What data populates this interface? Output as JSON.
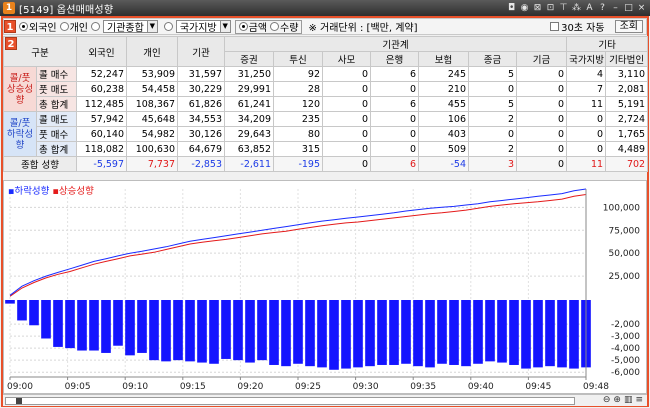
{
  "window": {
    "icon_text": "1",
    "title": "[5149] 옵션매매성향",
    "controls": [
      "◘",
      "◉",
      "⊠",
      "⊡",
      "⊤",
      "⁂",
      "A",
      "?",
      "–",
      "□",
      "×"
    ]
  },
  "toolbar": {
    "badge": "1",
    "investor_types": [
      {
        "label": "외국인",
        "selected": true
      },
      {
        "label": "개인",
        "selected": false
      },
      {
        "label": "",
        "selected": false
      },
      {
        "label": "",
        "selected": false
      }
    ],
    "institution_combo": "기관종합",
    "govt_combo": "국가지방",
    "amount_label": "금액",
    "amount_selected": true,
    "quantity_label": "수량",
    "unit_text": "※ 거래단위 : [백만, 계약]",
    "auto_label": "30초 자동",
    "query_button": "조회"
  },
  "grid": {
    "badge": "2",
    "header_top": {
      "category": "구분",
      "foreign": "외국인",
      "individual": "개인",
      "institution": "기관",
      "institution_group": "기관계",
      "other_group": "기타"
    },
    "header_sub": [
      "증권",
      "투신",
      "사모",
      "은행",
      "보험",
      "종금",
      "기금",
      "국가지방",
      "기타법인"
    ],
    "group_up": "콜/풋\n상승성향",
    "group_down": "콜/풋\n하락성향",
    "rows": [
      {
        "label": "콜 매수",
        "values": [
          "52,247",
          "53,909",
          "31,597",
          "31,250",
          "92",
          "0",
          "6",
          "245",
          "5",
          "0",
          "4",
          "3,110"
        ]
      },
      {
        "label": "풋 매도",
        "values": [
          "60,238",
          "54,458",
          "30,229",
          "29,991",
          "28",
          "0",
          "0",
          "210",
          "0",
          "0",
          "7",
          "2,081"
        ]
      },
      {
        "label": "총 합계",
        "values": [
          "112,485",
          "108,367",
          "61,826",
          "61,241",
          "120",
          "0",
          "6",
          "455",
          "5",
          "0",
          "11",
          "5,191"
        ]
      },
      {
        "label": "콜 매도",
        "values": [
          "57,942",
          "45,648",
          "34,553",
          "34,209",
          "235",
          "0",
          "0",
          "106",
          "2",
          "0",
          "0",
          "2,724"
        ]
      },
      {
        "label": "풋 매수",
        "values": [
          "60,140",
          "54,982",
          "30,126",
          "29,643",
          "80",
          "0",
          "0",
          "403",
          "0",
          "0",
          "0",
          "1,765"
        ]
      },
      {
        "label": "총 합계",
        "values": [
          "118,082",
          "100,630",
          "64,679",
          "63,852",
          "315",
          "0",
          "0",
          "509",
          "2",
          "0",
          "0",
          "4,489"
        ]
      }
    ],
    "summary": {
      "label": "종합 성향",
      "values": [
        "-5,597",
        "7,737",
        "-2,853",
        "-2,611",
        "-195",
        "0",
        "6",
        "-54",
        "3",
        "0",
        "11",
        "702"
      ],
      "colors": [
        "blue",
        "red",
        "blue",
        "blue",
        "blue",
        "black",
        "red",
        "blue",
        "red",
        "black",
        "red",
        "red"
      ]
    }
  },
  "chart_data": {
    "type": "line+bar",
    "legend": [
      {
        "name": "하락성향",
        "color": "#1a2cff"
      },
      {
        "name": "상승성향",
        "color": "#e41a1a"
      }
    ],
    "x_ticks": [
      "09:00",
      "09:05",
      "09:10",
      "09:15",
      "09:20",
      "09:25",
      "09:30",
      "09:35",
      "09:40",
      "09:45",
      "09:48"
    ],
    "upper_y_ticks": [
      "100,000",
      "75,000",
      "50,000",
      "25,000"
    ],
    "upper_y_values": [
      100000,
      75000,
      50000,
      25000
    ],
    "upper_ylim": [
      0,
      120000
    ],
    "lower_y_ticks": [
      "-2,000",
      "-3,000",
      "-4,000",
      "-5,000",
      "-6,000"
    ],
    "lower_y_values": [
      -2000,
      -3000,
      -4000,
      -5000,
      -6000
    ],
    "lower_ylim": [
      -6400,
      0
    ],
    "series_up": [
      3000,
      12000,
      18000,
      23000,
      27000,
      30000,
      34000,
      38000,
      41000,
      44000,
      47000,
      49000,
      51000,
      54000,
      57000,
      60000,
      62000,
      63500,
      65000,
      67000,
      69000,
      71000,
      72500,
      74000,
      76000,
      78000,
      80000,
      81500,
      83000,
      84000,
      85500,
      87000,
      88500,
      90000,
      91500,
      93000,
      94000,
      95500,
      97000,
      99000,
      101000,
      102500,
      104000,
      105000,
      106000,
      107500,
      109000,
      112000,
      114000
    ],
    "series_down": [
      4000,
      14000,
      20000,
      25000,
      29000,
      33000,
      37000,
      41000,
      44000,
      47000,
      50000,
      52000,
      54500,
      57000,
      60000,
      63000,
      65000,
      67000,
      69000,
      71000,
      73000,
      75000,
      77000,
      79000,
      81000,
      83000,
      85000,
      86500,
      88000,
      89500,
      91000,
      92500,
      94000,
      96000,
      97500,
      99000,
      100000,
      101000,
      102500,
      104000,
      106000,
      107500,
      109000,
      110500,
      112000,
      113500,
      115000,
      118000,
      120000
    ],
    "bars": [
      -300,
      -1700,
      -2100,
      -3200,
      -3900,
      -4000,
      -4200,
      -4200,
      -4400,
      -3800,
      -4600,
      -4400,
      -5000,
      -5100,
      -5000,
      -5100,
      -5200,
      -5300,
      -4900,
      -5000,
      -5200,
      -5000,
      -5400,
      -5500,
      -5300,
      -5500,
      -5600,
      -5800,
      -5700,
      -5600,
      -5500,
      -5400,
      -5400,
      -5300,
      -5500,
      -5600,
      -5300,
      -5400,
      -5500,
      -5300,
      -5100,
      -5200,
      -5400,
      -5700,
      -5600,
      -5500,
      -5600,
      -5700,
      -5600
    ]
  }
}
